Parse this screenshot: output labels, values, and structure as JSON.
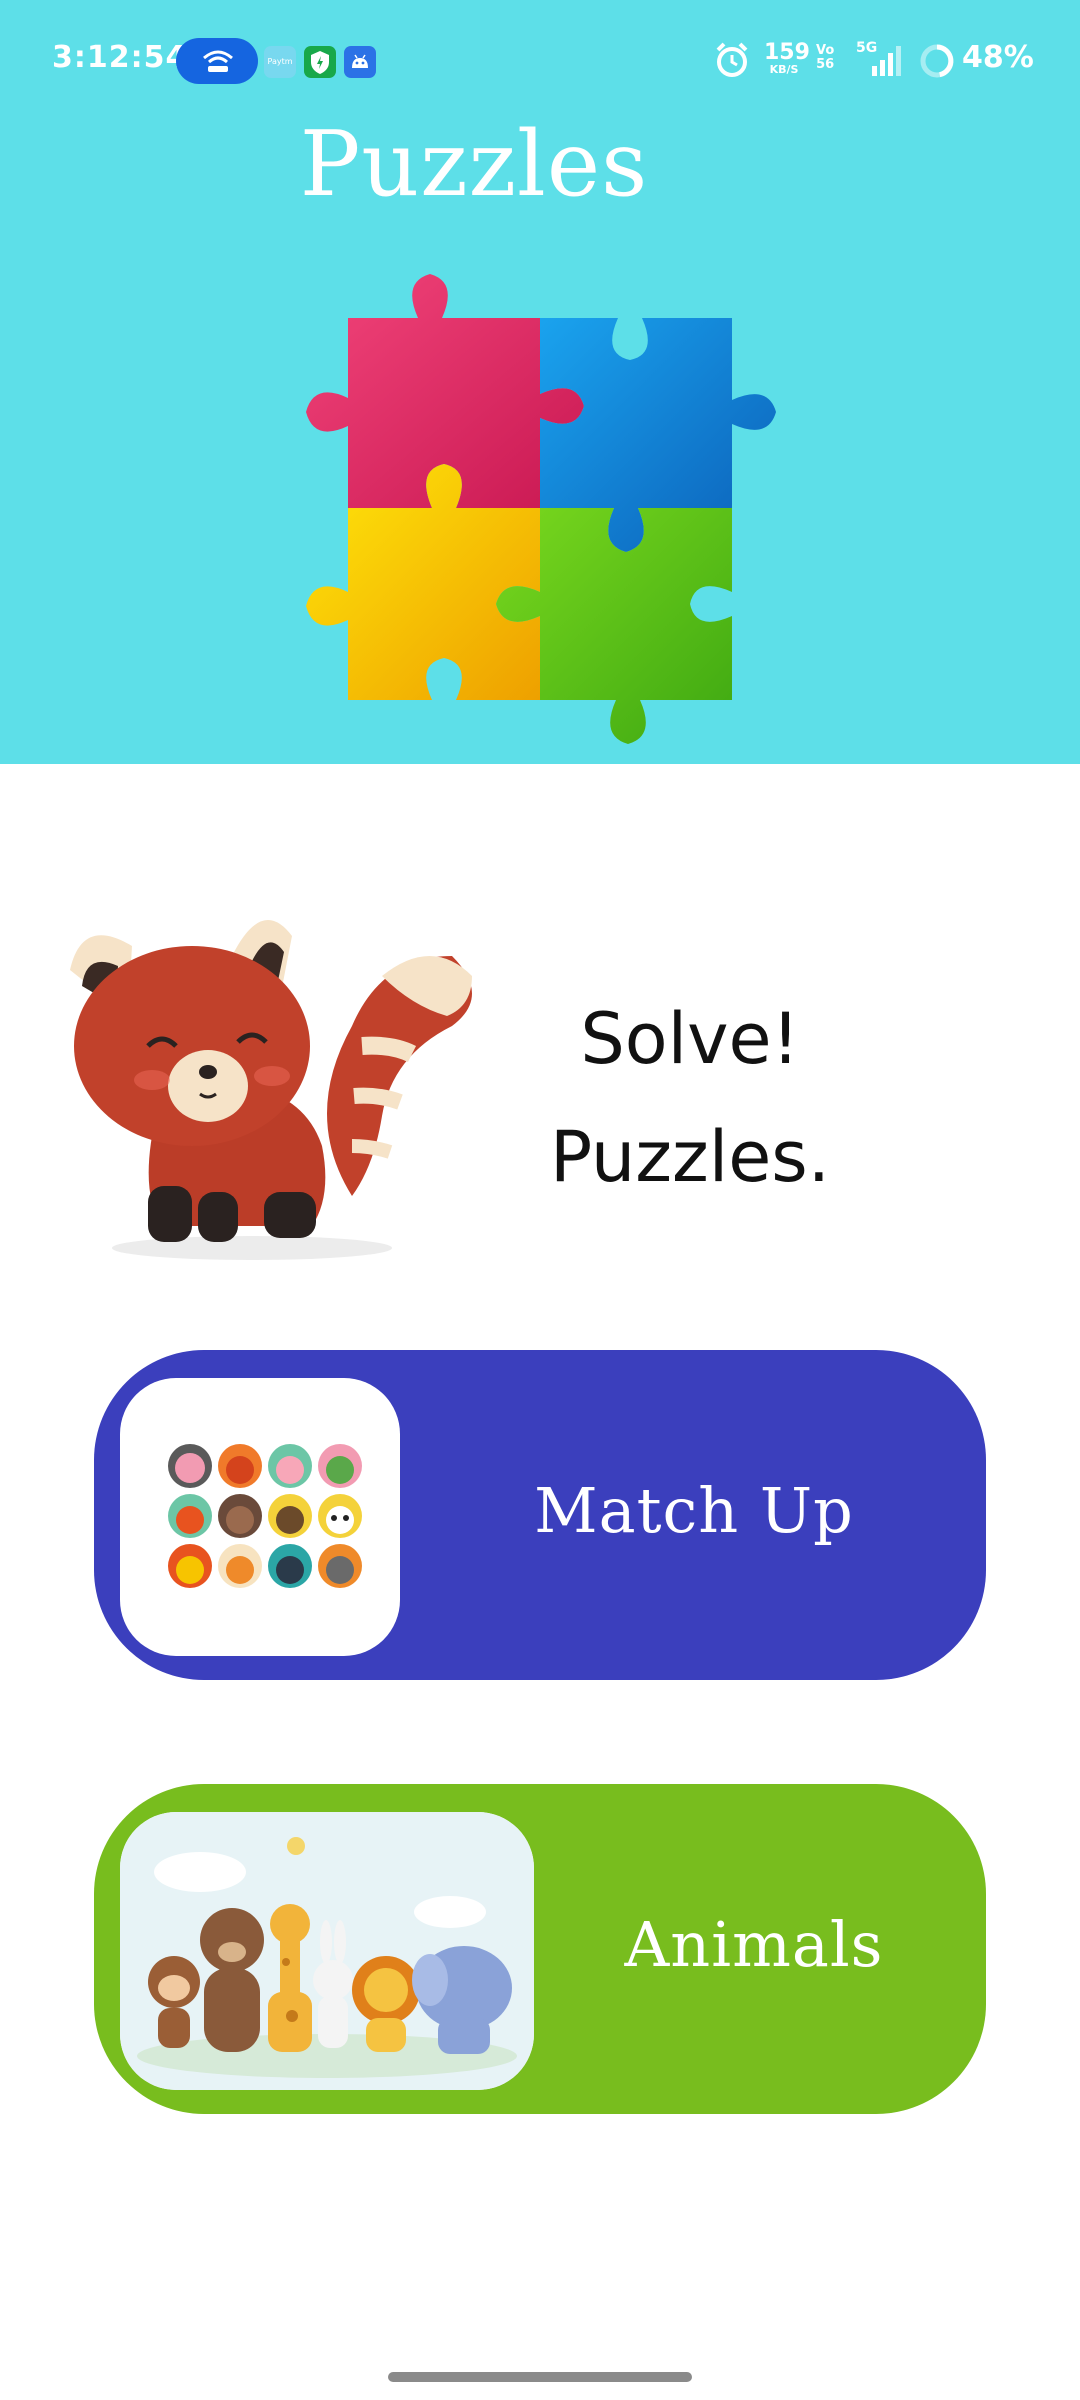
{
  "status_bar": {
    "time": "3:12:54",
    "speed_value": "159",
    "speed_unit": "KB/S",
    "volte_top": "Vo",
    "volte_bottom": "56",
    "network": "5G",
    "battery": "48%"
  },
  "header": {
    "title": "Puzzles",
    "background_color": "#5ddfe8"
  },
  "intro": {
    "line1": "Solve!",
    "line2": "Puzzles."
  },
  "menu": {
    "match_up": {
      "label": "Match Up",
      "color": "#3b3fbd",
      "icon": "animal-faces-grid-icon"
    },
    "animals": {
      "label": "Animals",
      "color": "#78bd1e",
      "icon": "animal-group-illustration"
    }
  },
  "colors": {
    "puzzle_pink": "#e8336b",
    "puzzle_blue": "#1186d9",
    "puzzle_yellow": "#f7c400",
    "puzzle_green": "#5ec21a"
  }
}
